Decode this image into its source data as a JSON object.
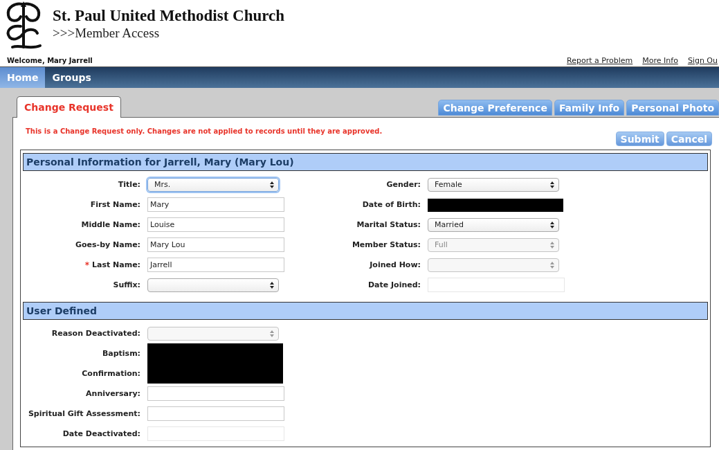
{
  "header": {
    "title": "St. Paul United Methodist Church",
    "subtitle": ">>>Member Access"
  },
  "welcome": "Welcome, Mary Jarrell",
  "top_links": [
    "Report a Problem",
    "More Info",
    "Sign Ou"
  ],
  "nav": [
    {
      "label": "Home",
      "selected": true
    },
    {
      "label": "Groups",
      "selected": false
    }
  ],
  "page_tabs": [
    {
      "label": "Change Request",
      "selected": true
    },
    {
      "label": "Change Preference",
      "selected": false
    },
    {
      "label": "Family Info",
      "selected": false
    },
    {
      "label": "Personal Photo",
      "selected": false
    }
  ],
  "notice": "This is a Change Request only. Changes are not applied to records until they are approved.",
  "actions": [
    "Submit",
    "Cancel"
  ],
  "sections": [
    {
      "title": "Personal Information for Jarrell, Mary (Mary Lou)",
      "columns": [
        [
          {
            "label": "Title:",
            "kind": "select",
            "value": "Mrs.",
            "disabled": false,
            "focused": true
          },
          {
            "label": "First Name:",
            "kind": "text",
            "value": "Mary",
            "disabled": false,
            "focused": false
          },
          {
            "label": "Middle Name:",
            "kind": "text",
            "value": "Louise",
            "disabled": false,
            "focused": false
          },
          {
            "label": "Goes-by Name:",
            "kind": "text",
            "value": "Mary Lou",
            "disabled": false,
            "focused": false
          },
          {
            "label": "Last Name:",
            "mark": "*",
            "kind": "text",
            "value": "Jarrell",
            "disabled": false,
            "focused": false
          },
          {
            "label": "Suffix:",
            "kind": "select",
            "disabled": false,
            "focused": false
          }
        ],
        [
          {
            "label": "Gender:",
            "kind": "select",
            "value": "Female",
            "disabled": false,
            "focused": false
          },
          {
            "label": "Date of Birth:",
            "kind": "redacted"
          },
          {
            "label": "Marital Status:",
            "kind": "select",
            "value": "Married",
            "disabled": false,
            "focused": false
          },
          {
            "label": "Member Status:",
            "kind": "select",
            "value": "Full",
            "disabled": true,
            "focused": false
          },
          {
            "label": "Joined How:",
            "kind": "select",
            "disabled": true,
            "focused": false
          },
          {
            "label": "Date Joined:",
            "kind": "text",
            "disabled": true,
            "focused": false
          }
        ]
      ]
    },
    {
      "title": "User Defined",
      "columns": [
        [
          {
            "label": "Reason Deactivated:",
            "kind": "select",
            "disabled": true,
            "focused": false
          },
          {
            "label": "Baptism:",
            "kind": "redacted"
          },
          {
            "label": "Confirmation:",
            "kind": "redacted"
          },
          {
            "label": "Anniversary:",
            "kind": "text",
            "disabled": false,
            "focused": false
          },
          {
            "label": "Spiritual Gift Assessment:",
            "kind": "text",
            "disabled": false,
            "focused": false
          },
          {
            "label": "Date Deactivated:",
            "kind": "text",
            "disabled": true,
            "focused": false
          }
        ]
      ]
    }
  ]
}
